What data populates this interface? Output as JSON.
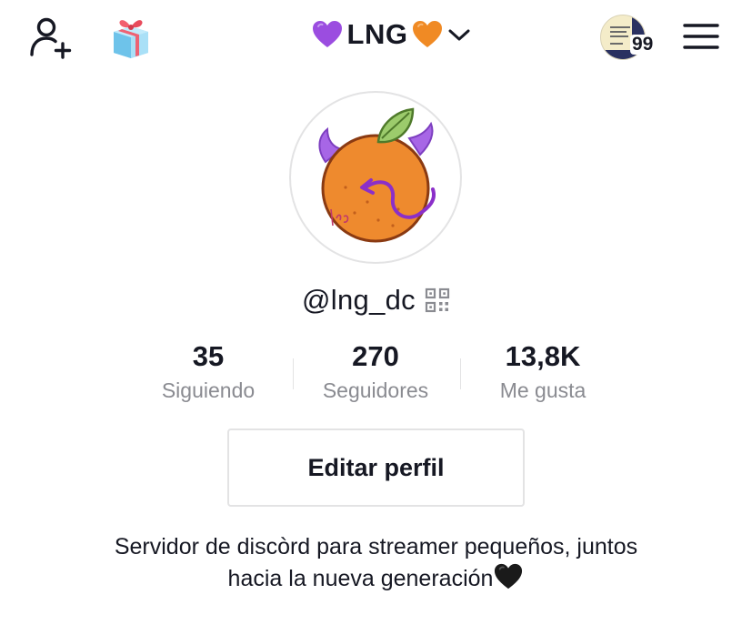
{
  "header": {
    "title": "LNG",
    "title_left_emoji": "purple-heart",
    "title_right_emoji": "orange-heart",
    "story_count": "99",
    "icons": {
      "add_user": "add-user-icon",
      "gift": "gift-icon",
      "dropdown": "chevron-down-icon",
      "menu": "hamburger-menu-icon"
    }
  },
  "profile": {
    "username": "@lng_dc",
    "avatar": "orange-devil-avatar",
    "stats": [
      {
        "value": "35",
        "label": "Siguiendo"
      },
      {
        "value": "270",
        "label": "Seguidores"
      },
      {
        "value": "13,8K",
        "label": "Me gusta"
      }
    ],
    "edit_button_label": "Editar perfil",
    "bio_line1": "Servidor de discòrd para streamer pequeños, juntos",
    "bio_line2": "hacia la nueva generación",
    "bio_emoji": "black-heart"
  },
  "colors": {
    "text_primary": "#161823",
    "text_secondary": "#8a8b91",
    "border": "#e3e3e4",
    "purple_heart": "#9b4de0",
    "orange_heart": "#f08a24"
  }
}
